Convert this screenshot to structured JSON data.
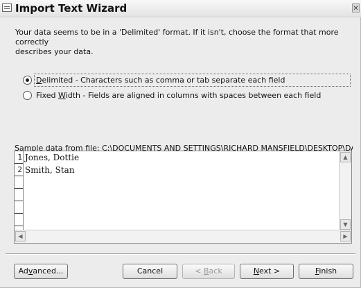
{
  "window": {
    "title": "Import Text Wizard",
    "close_glyph": "✕"
  },
  "intro": {
    "text": "Your data seems to be in a 'Delimited' format. If it isn't, choose the format that more correctly\ndescribes your data."
  },
  "options": [
    {
      "accel": "D",
      "label_rest": "elimited - Characters such as comma or tab separate each field",
      "selected": true
    },
    {
      "label_pre": "Fixed ",
      "accel": "W",
      "label_rest": "idth - Fields are aligned in columns with spaces between each field",
      "selected": false
    }
  ],
  "sample": {
    "label": "Sample data from file: C:\\DOCUMENTS AND SETTINGS\\RICHARD MANSFIELD\\DESKTOP\\DAT",
    "rows": [
      {
        "num": "1",
        "text": "Jones, Dottie"
      },
      {
        "num": "2",
        "text": "Smith, Stan"
      }
    ]
  },
  "scroll_glyphs": {
    "up": "▲",
    "down": "▼",
    "left": "◀",
    "right": "▶"
  },
  "buttons": {
    "advanced": {
      "pre": "Ad",
      "accel": "v",
      "post": "anced..."
    },
    "cancel": {
      "label": "Cancel"
    },
    "back": {
      "pre": "< ",
      "accel": "B",
      "post": "ack"
    },
    "next": {
      "pre": "",
      "accel": "N",
      "post": "ext >"
    },
    "finish": {
      "pre": "",
      "accel": "F",
      "post": "inish"
    }
  }
}
